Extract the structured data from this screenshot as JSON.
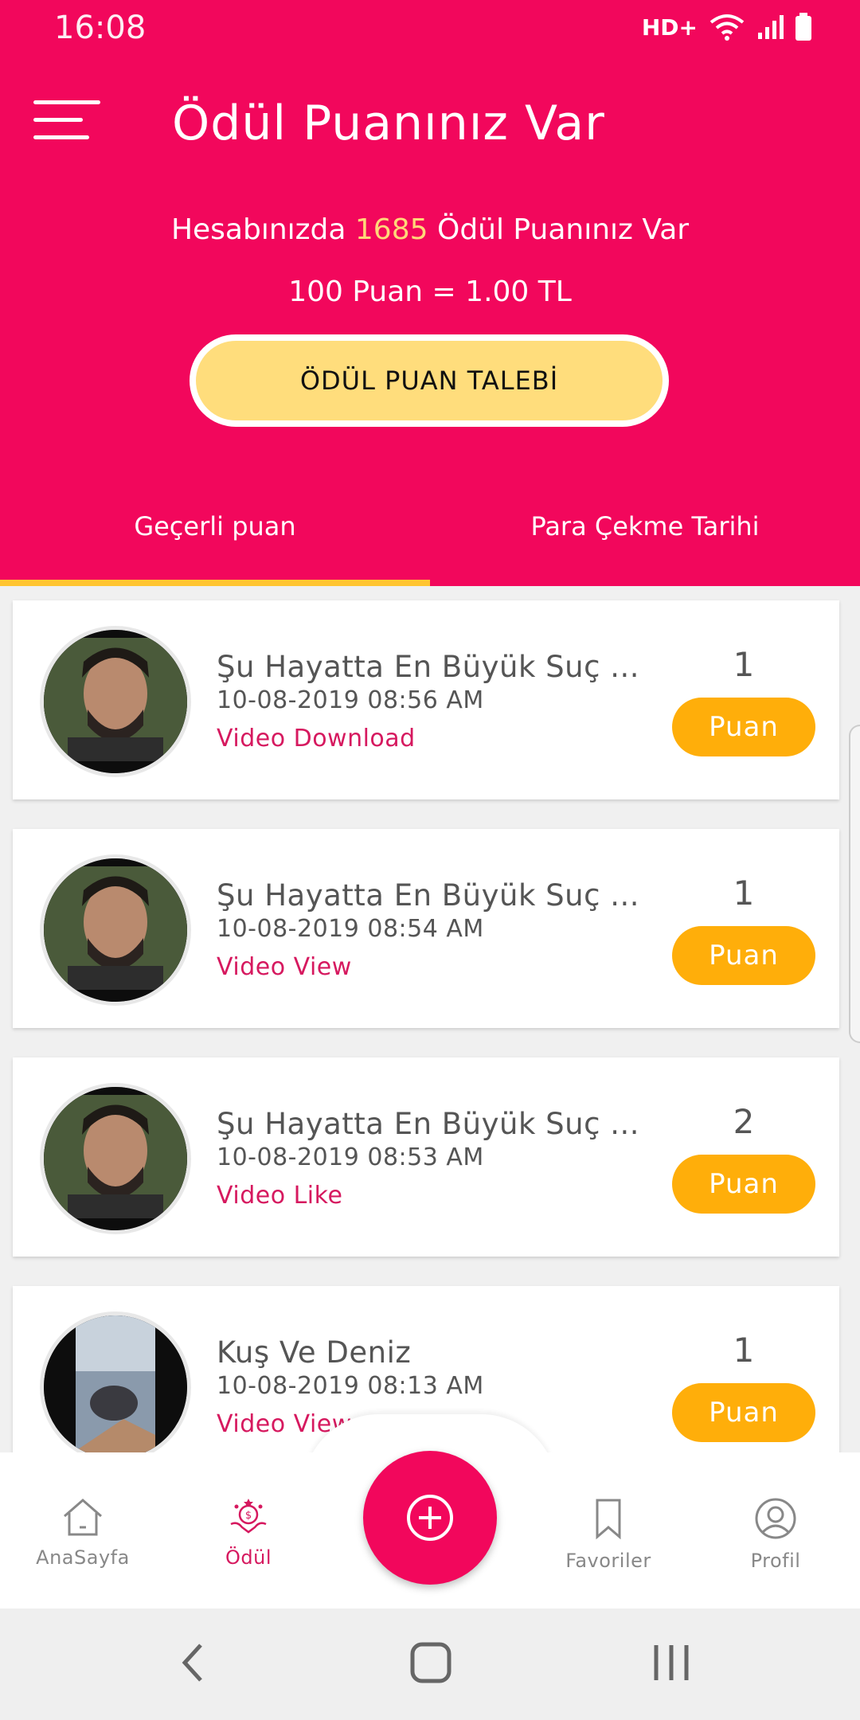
{
  "status_bar": {
    "time": "16:08",
    "network_label": "HD+"
  },
  "header": {
    "title": "Ödül Puanınız Var",
    "balance_prefix": "Hesabınızda",
    "balance_points": "1685",
    "balance_suffix": "Ödül Puanınız Var",
    "rate": "100 Puan = 1.00 TL",
    "claim_button": "ÖDÜL PUAN TALEBİ"
  },
  "tabs": [
    {
      "label": "Geçerli puan",
      "active": true
    },
    {
      "label": "Para Çekme Tarihi",
      "active": false
    }
  ],
  "items": [
    {
      "title": "Şu Hayatta En Büyük Suç ...",
      "date": "10-08-2019  08:56 AM",
      "type": "Video Download",
      "points": "1",
      "button": "Puan"
    },
    {
      "title": "Şu Hayatta En Büyük Suç ...",
      "date": "10-08-2019  08:54 AM",
      "type": "Video View",
      "points": "1",
      "button": "Puan"
    },
    {
      "title": "Şu Hayatta En Büyük Suç ...",
      "date": "10-08-2019  08:53 AM",
      "type": "Video Like",
      "points": "2",
      "button": "Puan"
    },
    {
      "title": "Kuş Ve Deniz",
      "date": "10-08-2019  08:13 AM",
      "type": "Video View",
      "points": "1",
      "button": "Puan"
    }
  ],
  "bottom_nav": {
    "home": "AnaSayfa",
    "reward": "Ödül",
    "favorites": "Favoriler",
    "profile": "Profil"
  },
  "colors": {
    "primary": "#F2075C",
    "accent_yellow": "#FFDD7C",
    "button_orange": "#FFAE0A",
    "tab_indicator": "#FFC530",
    "link_pink": "#D6195F"
  }
}
